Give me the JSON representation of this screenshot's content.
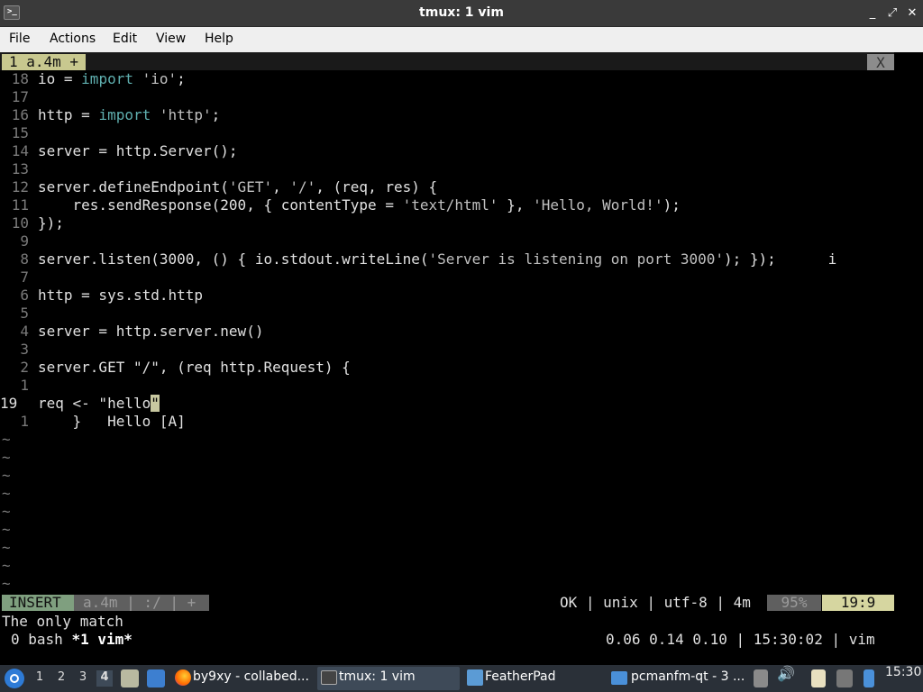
{
  "window": {
    "title": "tmux: 1 vim",
    "controls": {
      "minimize": "_",
      "maximize": "⤢",
      "close": "✕"
    }
  },
  "menubar": {
    "items": [
      "File",
      "Actions",
      "Edit",
      "View",
      "Help"
    ]
  },
  "vim": {
    "tab": {
      "label": "1 a.4m +",
      "close": "X"
    },
    "lines": [
      {
        "num": "18",
        "code": [
          [
            "io = ",
            "p"
          ],
          [
            "import",
            "k"
          ],
          [
            " 'io'",
            "s"
          ],
          [
            ";",
            "p"
          ]
        ]
      },
      {
        "num": "17",
        "code": []
      },
      {
        "num": "16",
        "code": [
          [
            "http = ",
            "p"
          ],
          [
            "import",
            "k"
          ],
          [
            " 'http'",
            "s"
          ],
          [
            ";",
            "p"
          ]
        ]
      },
      {
        "num": "15",
        "code": []
      },
      {
        "num": "14",
        "code": [
          [
            "server = http.Server();",
            "p"
          ]
        ]
      },
      {
        "num": "13",
        "code": []
      },
      {
        "num": "12",
        "code": [
          [
            "server.defineEndpoint(",
            "p"
          ],
          [
            "'GET'",
            "s"
          ],
          [
            ", ",
            "p"
          ],
          [
            "'/'",
            "s"
          ],
          [
            ", (req, res) {",
            "p"
          ]
        ]
      },
      {
        "num": "11",
        "code": [
          [
            "    res.sendResponse(200, { contentType = ",
            "p"
          ],
          [
            "'text/html'",
            "s"
          ],
          [
            " }, ",
            "p"
          ],
          [
            "'Hello, World!'",
            "s"
          ],
          [
            ");",
            "p"
          ]
        ]
      },
      {
        "num": "10",
        "code": [
          [
            "});",
            "p"
          ]
        ]
      },
      {
        "num": "9",
        "code": []
      },
      {
        "num": "8",
        "code": [
          [
            "server.listen(3000, () { io.stdout.writeLine(",
            "p"
          ],
          [
            "'Server is listening on port 3000'",
            "s"
          ],
          [
            "); });      i",
            "p"
          ]
        ]
      },
      {
        "num": "7",
        "code": []
      },
      {
        "num": "6",
        "code": [
          [
            "http = sys.std.http",
            "p"
          ]
        ]
      },
      {
        "num": "5",
        "code": []
      },
      {
        "num": "4",
        "code": [
          [
            "server = http.server.new()",
            "p"
          ]
        ]
      },
      {
        "num": "3",
        "code": []
      },
      {
        "num": "2",
        "code": [
          [
            "server.GET \"/\", (req http.Request) {",
            "p"
          ]
        ]
      },
      {
        "num": "1",
        "code": []
      },
      {
        "num": "19",
        "current": true,
        "code": [
          [
            "req <- \"hello",
            "p"
          ],
          [
            "\"",
            "c"
          ]
        ]
      },
      {
        "num": "1",
        "code": [
          [
            "    }   Hello [A]",
            "p"
          ]
        ]
      }
    ],
    "tildes": [
      "~",
      "~",
      "~",
      "~",
      "~",
      "~",
      "~",
      "~",
      "~"
    ],
    "status": {
      "mode": "INSERT",
      "file": "a.4m | :/ | +",
      "right": "OK | unix | utf-8 | 4m",
      "percent": "95%",
      "position": "19:9"
    },
    "message": "The only match"
  },
  "tmux": {
    "windows_prefix": "0 bash ",
    "active_window": "*1 vim*",
    "right": "0.06 0.14 0.10 | 15:30:02 | vim"
  },
  "taskbar": {
    "workspaces": [
      "1",
      "2",
      "3",
      "4"
    ],
    "active_workspace": "4",
    "tasks": [
      {
        "label": "by9xy - collabed...",
        "icon": "firefox-icon"
      },
      {
        "label": "tmux: 1 vim",
        "icon": "terminal-icon"
      },
      {
        "label": "FeatherPad",
        "icon": "featherpad-icon"
      },
      {
        "label": "pcmanfm-qt - 3 ...",
        "icon": "folder-icon"
      }
    ],
    "clock": "15:30"
  },
  "colors": {
    "accent": "#c8c88f",
    "insert_mode": "#7f9f7f",
    "keyword": "#5fafaf"
  }
}
